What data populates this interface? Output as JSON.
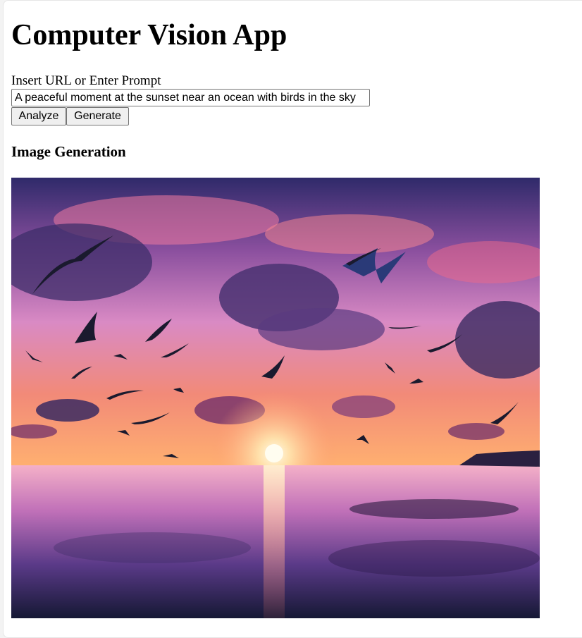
{
  "app": {
    "title": "Computer Vision App"
  },
  "form": {
    "label": "Insert URL or Enter Prompt",
    "input_value": "A peaceful moment at the sunset near an ocean with birds in the sky",
    "analyze_label": "Analyze",
    "generate_label": "Generate"
  },
  "result": {
    "heading": "Image Generation",
    "image_alt": "sunset-over-ocean-with-birds",
    "colors": {
      "sky_top": "#3a2a6e",
      "sky_mid": "#c86ab8",
      "sky_low": "#f57a5a",
      "sun": "#fff6d8",
      "water_top": "#e8a0c8",
      "water_bottom": "#1c1a3e",
      "cloud_dark": "#4a3272",
      "bird": "#1a1a2e"
    }
  }
}
